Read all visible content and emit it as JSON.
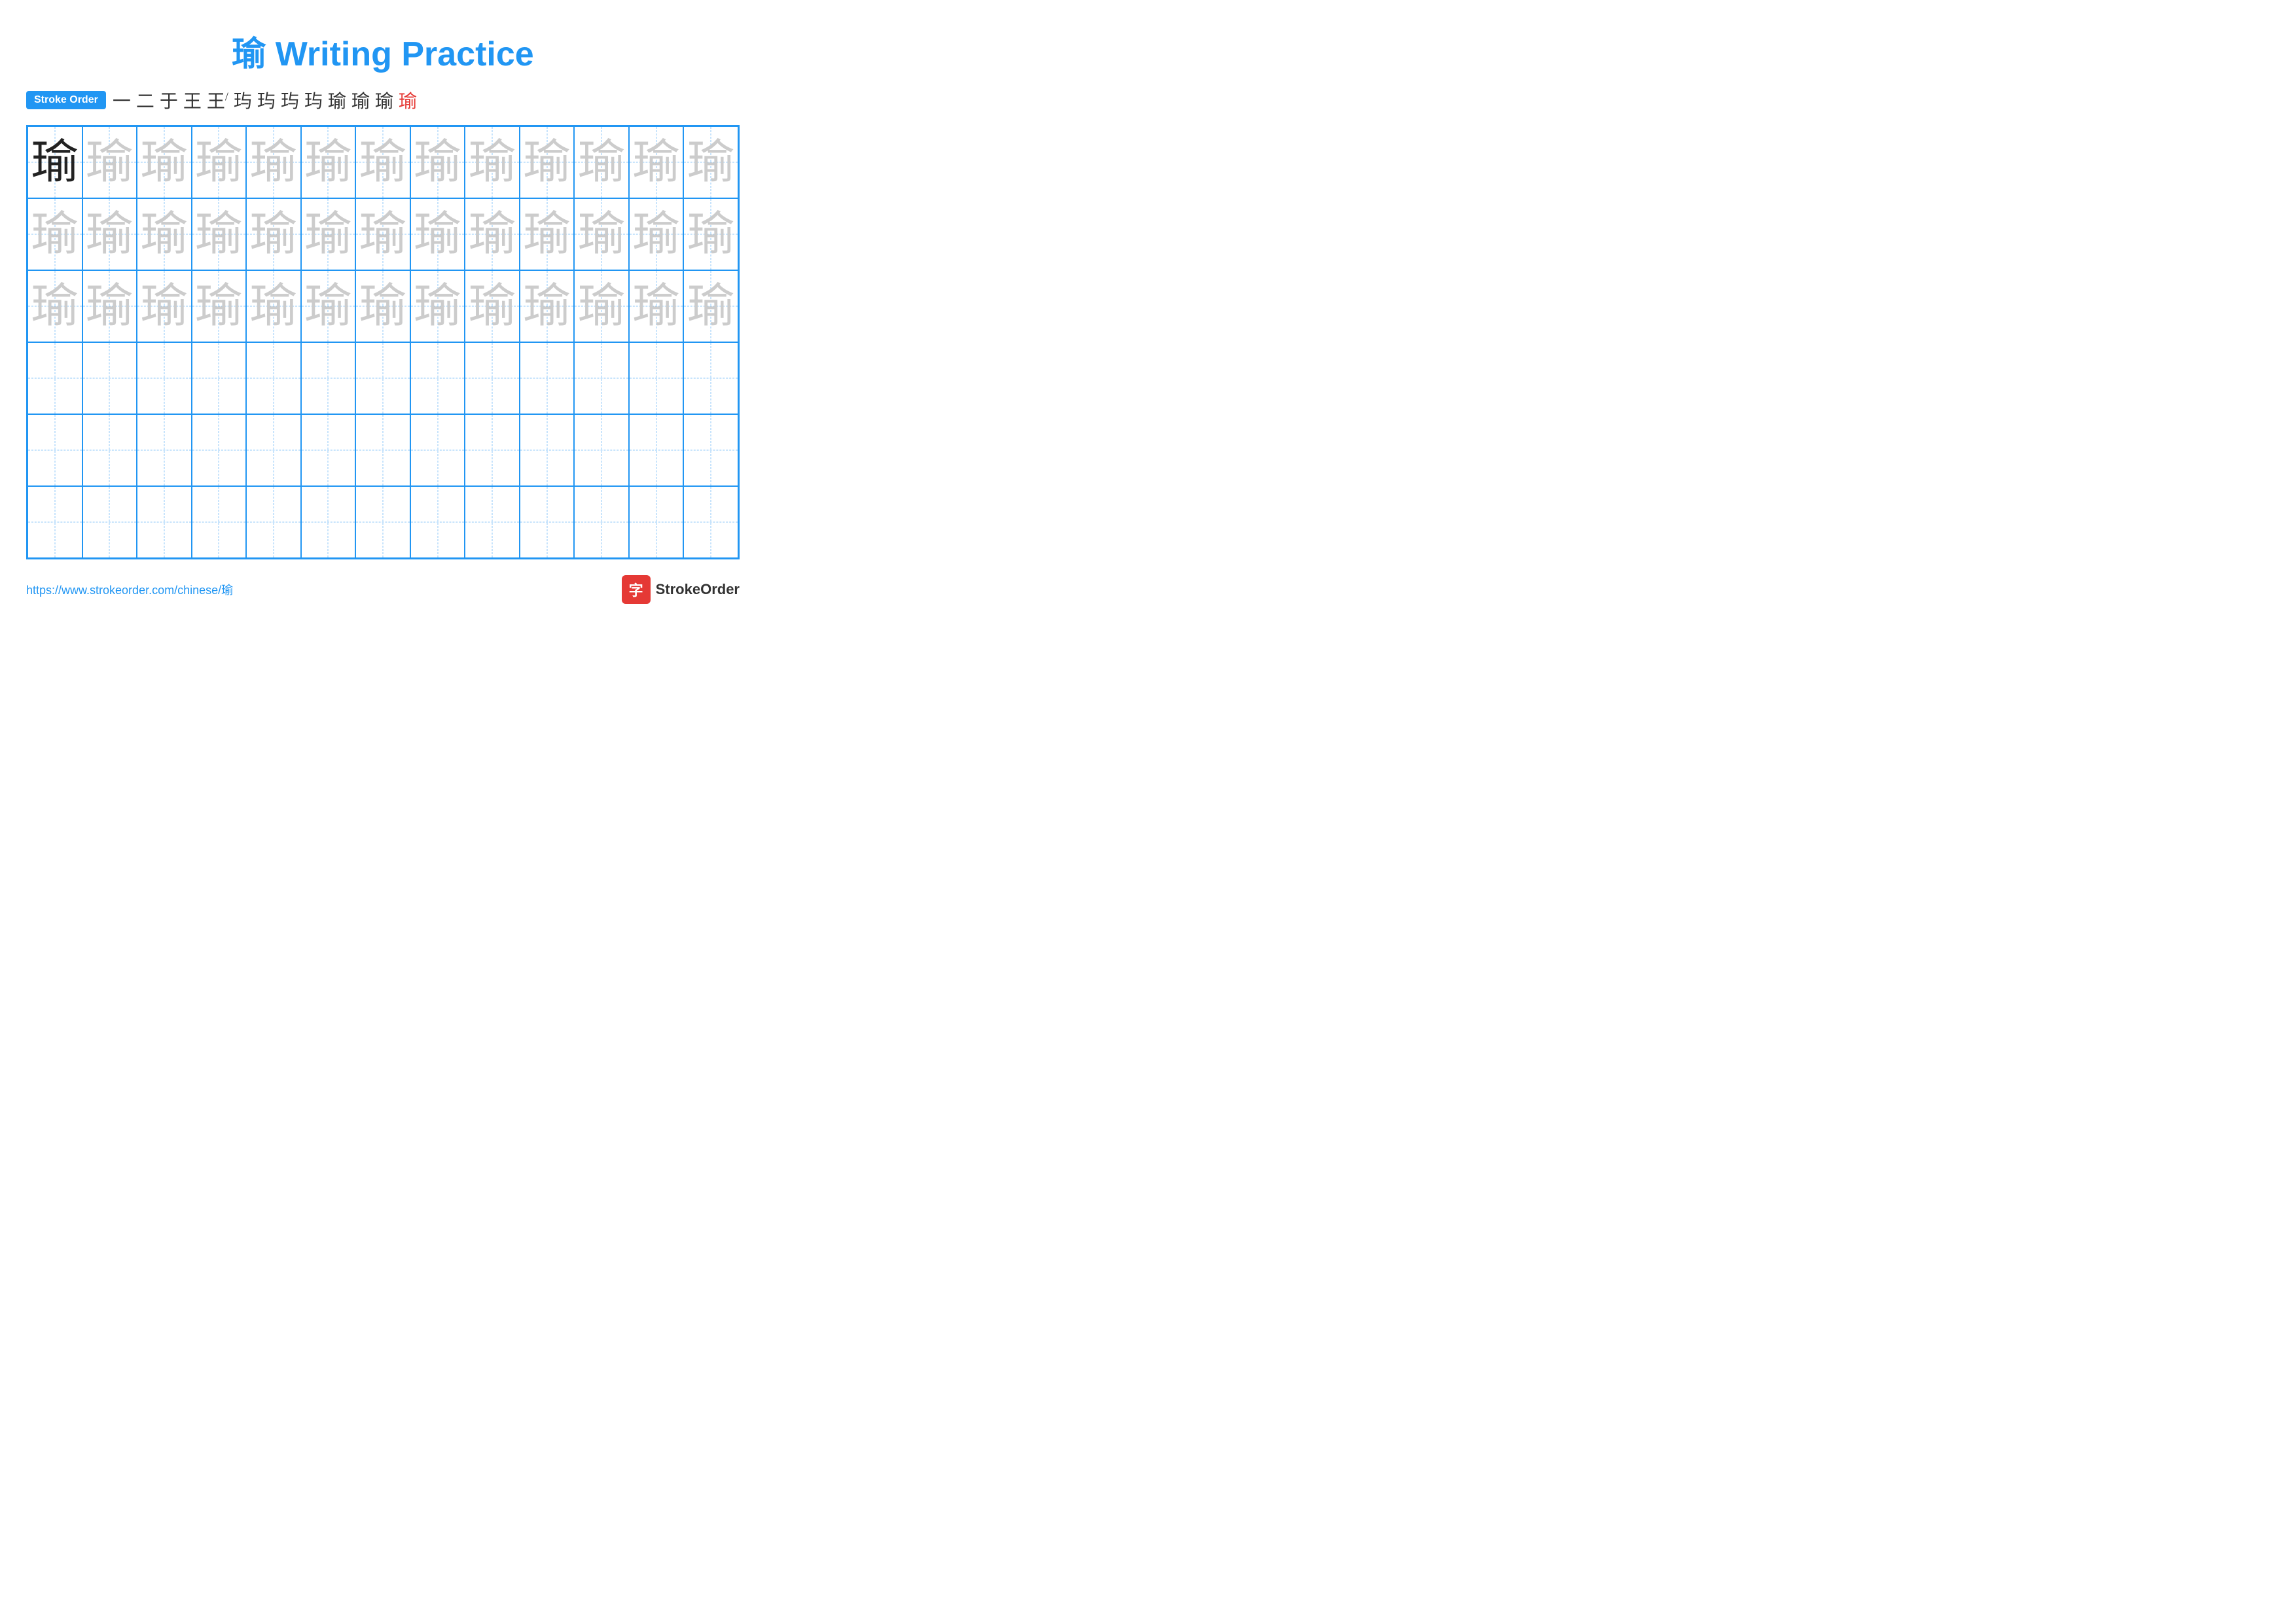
{
  "title": "瑜 Writing Practice",
  "stroke_order": {
    "badge_label": "Stroke Order",
    "strokes": [
      "一",
      "二",
      "于",
      "王",
      "王'",
      "玙",
      "玙",
      "玙",
      "玙",
      "瑜",
      "瑜",
      "瑜",
      "瑜"
    ],
    "last_stroke_red": true
  },
  "grid": {
    "rows": 6,
    "cols": 13,
    "character": "瑜",
    "row_styles": [
      "dark_first_light_rest",
      "all_light",
      "all_light",
      "empty",
      "empty",
      "empty"
    ]
  },
  "footer": {
    "url": "https://www.strokeorder.com/chinese/瑜",
    "brand_name": "StrokeOrder",
    "brand_char": "字"
  }
}
